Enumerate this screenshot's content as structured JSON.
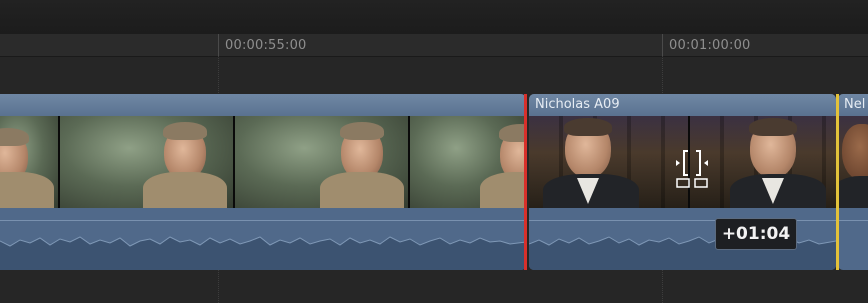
{
  "ruler": {
    "timecodes": [
      "00:00:55:00",
      "00:01:00:00"
    ]
  },
  "clips": [
    {
      "name": ""
    },
    {
      "name": "Nicholas A09"
    },
    {
      "name": "Nel"
    }
  ],
  "trim": {
    "offset_label": "+01:04"
  },
  "colors": {
    "clip_blue": "#5f7896",
    "edit_point_red": "#d8302b",
    "edit_point_yellow": "#e3c23a"
  },
  "icons": [
    "trim-ripple-cursor-icon"
  ]
}
